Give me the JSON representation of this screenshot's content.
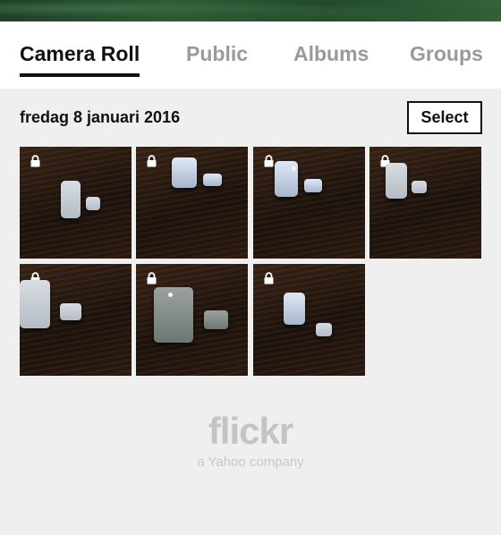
{
  "header": {
    "tabs": [
      {
        "label": "Camera Roll",
        "active": true
      },
      {
        "label": "Public",
        "active": false
      },
      {
        "label": "Albums",
        "active": false
      },
      {
        "label": "Groups",
        "active": false
      }
    ]
  },
  "section": {
    "date_title": "fredag 8 januari 2016",
    "select_label": "Select"
  },
  "photos": [
    {
      "locked": true,
      "icon": "lock-icon"
    },
    {
      "locked": true,
      "icon": "lock-icon"
    },
    {
      "locked": true,
      "icon": "lock-icon"
    },
    {
      "locked": true,
      "icon": "lock-icon"
    },
    {
      "locked": true,
      "icon": "lock-icon"
    },
    {
      "locked": true,
      "icon": "lock-icon"
    },
    {
      "locked": true,
      "icon": "lock-icon"
    }
  ],
  "footer": {
    "logo": "flickr",
    "tagline": "a Yahoo company"
  },
  "colors": {
    "active_tab": "#111111",
    "inactive_tab": "#9a9a9a",
    "background": "#efefef"
  }
}
